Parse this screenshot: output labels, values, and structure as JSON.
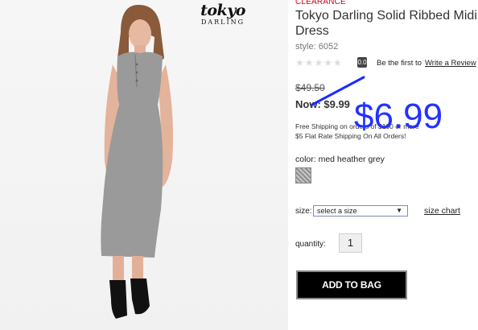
{
  "brand": {
    "logo_line1": "tokyo",
    "logo_line2": "DARLING"
  },
  "product": {
    "badge": "CLEARANCE",
    "title": "Tokyo Darling Solid Ribbed Midi Dress",
    "style": "style: 6052",
    "rating_badge": "0.0",
    "stars": "★★★★★",
    "rating_text": "Be the first to",
    "review_link": "Write a Review",
    "old_price": "$49.50",
    "now_price": "Now: $9.99",
    "sale_price": "$6.99",
    "shipping_line1": "Free Shipping on orders of $100 or more",
    "shipping_line2": "$5 Flat Rate Shipping On All Orders!",
    "color_label": "color: med heather grey",
    "size_label": "size:",
    "size_select": "select a size",
    "size_select_arrow": "▼",
    "size_chart": "size chart",
    "quantity_label": "quantity:",
    "quantity_value": "1",
    "add_to_bag": "ADD TO BAG"
  },
  "colors": {
    "clearance": "#d0021b",
    "sale_price": "#2332ff",
    "strike_line": "#1a2cff",
    "button_bg": "#000000"
  }
}
